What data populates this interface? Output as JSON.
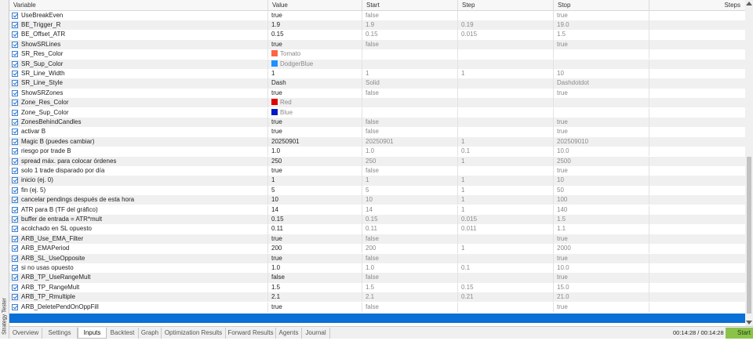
{
  "sidebar": {
    "label": "Strategy Tester"
  },
  "columns": [
    "Variable",
    "Value",
    "Start",
    "Step",
    "Stop",
    "Steps"
  ],
  "colors": {
    "accent": "#0a6fd6",
    "start_button": "#8bc34a"
  },
  "rows": [
    {
      "name": "UseBreakEven",
      "value": "true",
      "start": "false",
      "step": "",
      "stop": "true"
    },
    {
      "name": "BE_Trigger_R",
      "value": "1.9",
      "start": "1.9",
      "step": "0.19",
      "stop": "19.0"
    },
    {
      "name": "BE_Offset_ATR",
      "value": "0.15",
      "start": "0.15",
      "step": "0.015",
      "stop": "1.5"
    },
    {
      "name": "ShowSRLines",
      "value": "true",
      "start": "false",
      "step": "",
      "stop": "true"
    },
    {
      "name": "SR_Res_Color",
      "value": "Tomato",
      "swatch": "#ff6347",
      "start": "",
      "step": "",
      "stop": ""
    },
    {
      "name": "SR_Sup_Color",
      "value": "DodgerBlue",
      "swatch": "#1e90ff",
      "start": "",
      "step": "",
      "stop": ""
    },
    {
      "name": "SR_Line_Width",
      "value": "1",
      "start": "1",
      "step": "1",
      "stop": "10"
    },
    {
      "name": "SR_Line_Style",
      "value": "Dash",
      "start": "Solid",
      "step": "",
      "stop": "Dashdotdot"
    },
    {
      "name": "ShowSRZones",
      "value": "true",
      "start": "false",
      "step": "",
      "stop": "true"
    },
    {
      "name": "Zone_Res_Color",
      "value": "Red",
      "swatch": "#e00000",
      "start": "",
      "step": "",
      "stop": ""
    },
    {
      "name": "Zone_Sup_Color",
      "value": "Blue",
      "swatch": "#0018c8",
      "start": "",
      "step": "",
      "stop": ""
    },
    {
      "name": "ZonesBehindCandles",
      "value": "true",
      "start": "false",
      "step": "",
      "stop": "true"
    },
    {
      "name": "activar B",
      "value": "true",
      "start": "false",
      "step": "",
      "stop": "true"
    },
    {
      "name": "Magic B (puedes cambiar)",
      "value": "20250901",
      "start": "20250901",
      "step": "1",
      "stop": "202509010"
    },
    {
      "name": "riesgo por trade B",
      "value": "1.0",
      "start": "1.0",
      "step": "0.1",
      "stop": "10.0"
    },
    {
      "name": "spread máx. para colocar órdenes",
      "value": "250",
      "start": "250",
      "step": "1",
      "stop": "2500"
    },
    {
      "name": "solo 1 trade disparado por día",
      "value": "true",
      "start": "false",
      "step": "",
      "stop": "true"
    },
    {
      "name": "inicio (ej. 0)",
      "value": "1",
      "start": "1",
      "step": "1",
      "stop": "10"
    },
    {
      "name": "fin    (ej. 5)",
      "value": "5",
      "start": "5",
      "step": "1",
      "stop": "50"
    },
    {
      "name": "cancelar pendings después de esta hora",
      "value": "10",
      "start": "10",
      "step": "1",
      "stop": "100"
    },
    {
      "name": "ATR para B (TF del gráfico)",
      "value": "14",
      "start": "14",
      "step": "1",
      "stop": "140"
    },
    {
      "name": "buffer de entrada = ATR*mult",
      "value": "0.15",
      "start": "0.15",
      "step": "0.015",
      "stop": "1.5"
    },
    {
      "name": "acolchado en SL opuesto",
      "value": "0.11",
      "start": "0.11",
      "step": "0.011",
      "stop": "1.1"
    },
    {
      "name": "ARB_Use_EMA_Filter",
      "value": "true",
      "start": "false",
      "step": "",
      "stop": "true"
    },
    {
      "name": "ARB_EMAPeriod",
      "value": "200",
      "start": "200",
      "step": "1",
      "stop": "2000"
    },
    {
      "name": "ARB_SL_UseOpposite",
      "value": "true",
      "start": "false",
      "step": "",
      "stop": "true"
    },
    {
      "name": "si no usas opuesto",
      "value": "1.0",
      "start": "1.0",
      "step": "0.1",
      "stop": "10.0"
    },
    {
      "name": "ARB_TP_UseRangeMult",
      "value": "false",
      "start": "false",
      "step": "",
      "stop": "true"
    },
    {
      "name": "ARB_TP_RangeMult",
      "value": "1.5",
      "start": "1.5",
      "step": "0.15",
      "stop": "15.0"
    },
    {
      "name": "ARB_TP_Rmultiple",
      "value": "2.1",
      "start": "2.1",
      "step": "0.21",
      "stop": "21.0"
    },
    {
      "name": "ARB_DeletePendOnOppFill",
      "value": "true",
      "start": "false",
      "step": "",
      "stop": "true"
    }
  ],
  "tabs": [
    "Overview",
    "Settings",
    "Inputs",
    "Backtest",
    "Graph",
    "Optimization Results",
    "Forward Results",
    "Agents",
    "Journal"
  ],
  "active_tab": "Inputs",
  "timer": "00:14:28 / 00:14:28",
  "start_label": "Start"
}
